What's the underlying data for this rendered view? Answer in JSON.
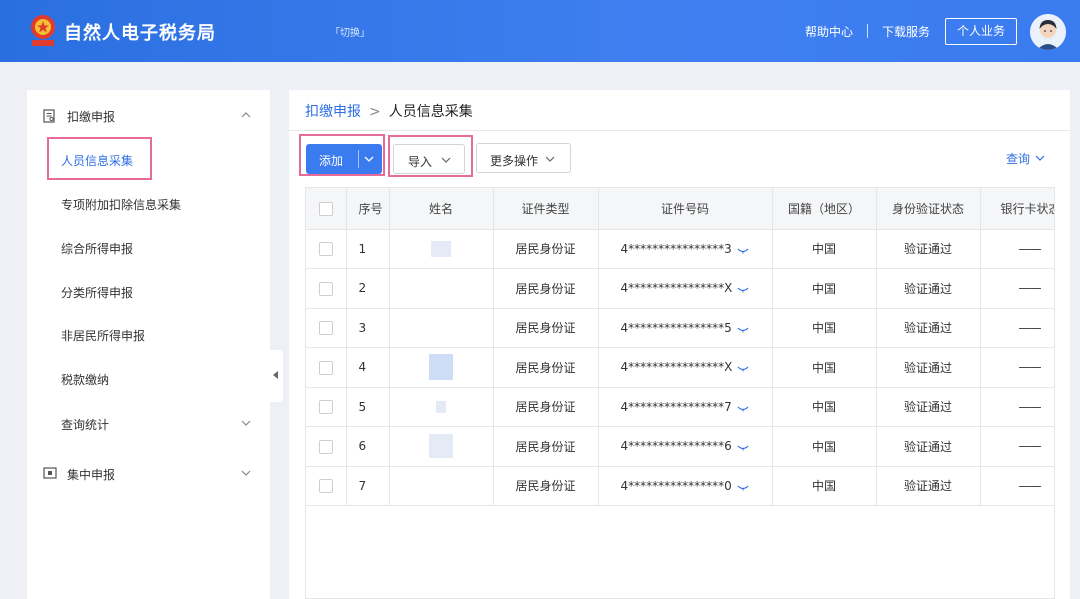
{
  "header": {
    "app_title": "自然人电子税务局",
    "switch_label": "「切换」",
    "help_label": "帮助中心",
    "download_label": "下载服务",
    "personal_label": "个人业务",
    "brand_color": "#3a7bf0"
  },
  "sidebar": {
    "group1_label": "扣缴申报",
    "items": [
      {
        "label": "人员信息采集",
        "active": true
      },
      {
        "label": "专项附加扣除信息采集"
      },
      {
        "label": "综合所得申报"
      },
      {
        "label": "分类所得申报"
      },
      {
        "label": "非居民所得申报"
      },
      {
        "label": "税款缴纳"
      },
      {
        "label": "查询统计"
      }
    ],
    "group2_label": "集中申报"
  },
  "breadcrumb": {
    "parent": "扣缴申报",
    "separator": ">",
    "current": "人员信息采集"
  },
  "toolbar": {
    "add_label": "添加",
    "import_label": "导入",
    "more_label": "更多操作",
    "query_label": "查询"
  },
  "table": {
    "headers": [
      "序号",
      "姓名",
      "证件类型",
      "证件号码",
      "国籍（地区）",
      "身份验证状态",
      "银行卡状态"
    ],
    "rows": [
      {
        "seq": "1",
        "id_type": "居民身份证",
        "id_number": "4****************3",
        "nationality": "中国",
        "status": "验证通过",
        "bank": "——"
      },
      {
        "seq": "2",
        "id_type": "居民身份证",
        "id_number": "4****************X",
        "nationality": "中国",
        "status": "验证通过",
        "bank": "——"
      },
      {
        "seq": "3",
        "id_type": "居民身份证",
        "id_number": "4****************5",
        "nationality": "中国",
        "status": "验证通过",
        "bank": "——"
      },
      {
        "seq": "4",
        "id_type": "居民身份证",
        "id_number": "4****************X",
        "nationality": "中国",
        "status": "验证通过",
        "bank": "——"
      },
      {
        "seq": "5",
        "id_type": "居民身份证",
        "id_number": "4****************7",
        "nationality": "中国",
        "status": "验证通过",
        "bank": "——"
      },
      {
        "seq": "6",
        "id_type": "居民身份证",
        "id_number": "4****************6",
        "nationality": "中国",
        "status": "验证通过",
        "bank": "——"
      },
      {
        "seq": "7",
        "id_type": "居民身份证",
        "id_number": "4****************0",
        "nationality": "中国",
        "status": "验证通过",
        "bank": "——"
      }
    ]
  }
}
